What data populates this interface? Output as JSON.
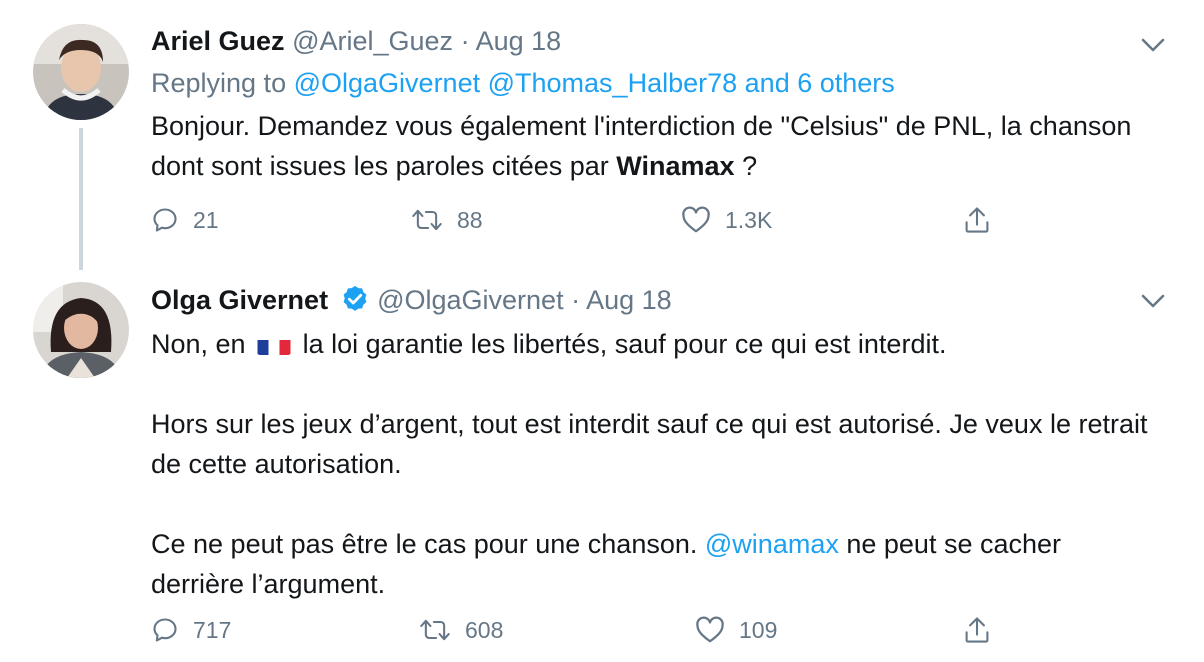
{
  "tweets": [
    {
      "author_name": "Ariel Guez",
      "handle": "@Ariel_Guez",
      "dot": "·",
      "date": "Aug 18",
      "replying_prefix": "Replying to",
      "replying_user1": "@OlgaGivernet",
      "replying_user2": "@Thomas_Halber78",
      "replying_others": "and 6 others",
      "text_part1": "Bonjour. Demandez vous également l'interdiction de \"Celsius\" de PNL, la chanson dont sont issues les paroles citées par",
      "text_bold": "Winamax",
      "text_part2": " ?",
      "reply_count": "21",
      "retweet_count": "88",
      "like_count": "1.3K"
    },
    {
      "author_name": "Olga Givernet",
      "handle": "@OlgaGivernet",
      "dot": "·",
      "date": "Aug 18",
      "para1_a": "Non, en",
      "para1_b": "la loi garantie les libertés, sauf pour ce qui est interdit.",
      "para2": "Hors sur les jeux d’argent, tout est interdit sauf ce qui est autorisé. Je veux le retrait de cette autorisation.",
      "para3_a": "Ce ne peut pas être le cas pour une chanson.",
      "para3_mention": "@winamax",
      "para3_b": "ne peut se cacher derrière l’argument.",
      "reply_count": "717",
      "retweet_count": "608",
      "like_count": "109"
    }
  ],
  "colors": {
    "accent": "#1da1f2",
    "muted": "#657786",
    "text": "#14171a",
    "thread_line": "#ccd6dd"
  },
  "icons": [
    "reply-icon",
    "retweet-icon",
    "like-icon",
    "share-icon",
    "chevron-down-icon",
    "verified-badge-icon",
    "france-flag-emoji"
  ]
}
